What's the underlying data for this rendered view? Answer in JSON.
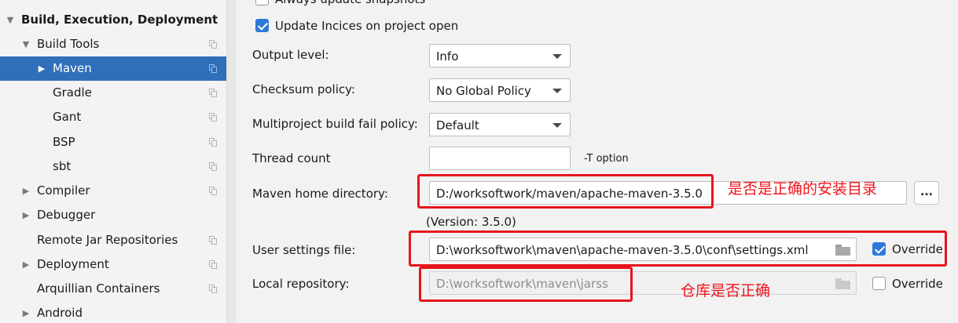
{
  "sidebar": {
    "items": [
      {
        "label": "Build, Execution, Deployment",
        "arrow": "▼",
        "bold": true
      },
      {
        "label": "Build Tools",
        "arrow": "▼"
      },
      {
        "label": "Maven",
        "arrow": "▶"
      },
      {
        "label": "Gradle"
      },
      {
        "label": "Gant"
      },
      {
        "label": "BSP"
      },
      {
        "label": "sbt"
      },
      {
        "label": "Compiler",
        "arrow": "▶"
      },
      {
        "label": "Debugger",
        "arrow": "▶"
      },
      {
        "label": "Remote Jar Repositories"
      },
      {
        "label": "Deployment",
        "arrow": "▶"
      },
      {
        "label": "Arquillian Containers"
      },
      {
        "label": "Android",
        "arrow": "▶"
      }
    ]
  },
  "settings": {
    "always_update_snapshots": {
      "label": "Always update snapshots",
      "checked": false
    },
    "update_indices": {
      "label": "Update Incices on project open",
      "checked": true
    },
    "output_level": {
      "label": "Output level:",
      "value": "Info"
    },
    "checksum_policy": {
      "label": "Checksum policy:",
      "value": "No Global Policy"
    },
    "multiproject_fail_policy": {
      "label": "Multiproject build fail policy:",
      "value": "Default"
    },
    "thread_count": {
      "label": "Thread count",
      "value": "",
      "hint": "-T option"
    },
    "maven_home": {
      "label": "Maven home directory:",
      "value": "D:/worksoftwork/maven/apache-maven-3.5.0",
      "version": "(Version: 3.5.0)",
      "browse": "..."
    },
    "user_settings": {
      "label": "User settings file:",
      "value": "D:\\worksoftwork\\maven\\apache-maven-3.5.0\\conf\\settings.xml",
      "override_label": "Override",
      "override_checked": true
    },
    "local_repository": {
      "label": "Local repository:",
      "value": "D:\\worksoftwork\\maven\\jarss",
      "override_label": "Override",
      "override_checked": false
    }
  },
  "annotations": {
    "maven_home_note": "是否是正确的安装目录",
    "local_repo_note": "仓库是否正确"
  },
  "colors": {
    "selection": "#2f6fb9",
    "checkbox_accent": "#2f78d8",
    "annotation_red": "#e8141c"
  }
}
